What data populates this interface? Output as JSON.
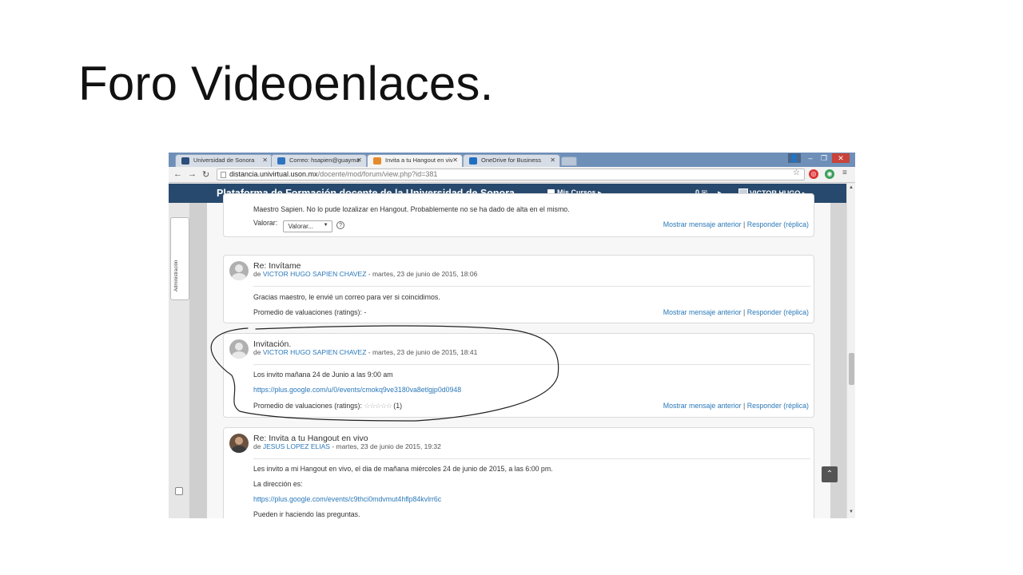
{
  "slide": {
    "title": "Foro Videoenlaces."
  },
  "browser": {
    "tabs": [
      {
        "label": "Universidad de Sonora",
        "icon": "university-favicon-icon"
      },
      {
        "label": "Correo: hsapien@guayma",
        "icon": "mail-favicon-icon"
      },
      {
        "label": "Invita a tu Hangout en viv",
        "icon": "moodle-favicon-icon"
      },
      {
        "label": "OneDrive for Business",
        "icon": "onedrive-favicon-icon"
      }
    ],
    "active_tab": 2,
    "url_host": "distancia.univirtual.uson.mx",
    "url_path": "/docente/mod/forum/view.php?id=381"
  },
  "site": {
    "title": "Plataforma de Formación docente de la Universidad de Sonora",
    "courses_label": "Mis Cursos",
    "messages_count": "0",
    "user_name": "VICTOR HUGO",
    "brand_color": "#27496d"
  },
  "sidebar": {
    "admin_label": "Administración"
  },
  "forum": {
    "action_prev": "Mostrar mensaje anterior",
    "action_reply": "Responder (réplica)",
    "partial_post": {
      "text": "Maestro Sapien. No lo pude lozalizar en Hangout. Probablemente no se ha dado de alta en el mismo.",
      "rating_label": "Valorar:",
      "rating_select": "Valorar..."
    },
    "posts": [
      {
        "subject": "Re: Invítame",
        "by": "de",
        "author": "VICTOR HUGO SAPIEN CHAVEZ",
        "date": " - martes, 23 de junio de 2015, 18:06",
        "body": [
          "Gracias maestro, le envié un correo para ver si coincidimos."
        ],
        "ratings": "Promedio de valuaciones (ratings): -"
      },
      {
        "subject": "Invitación.",
        "by": "de",
        "author": "VICTOR HUGO SAPIEN CHAVEZ",
        "date": " - martes, 23 de junio de 2015, 18:41",
        "body": [
          "Los invito mañana 24 de Junio a las 9:00 am"
        ],
        "link": "https://plus.google.com/u/0/events/cmokq9ve3180va8etlgjp0d0948",
        "ratings": "Promedio de valuaciones (ratings):",
        "stars": "☆☆☆☆☆",
        "rating_count": "(1)"
      },
      {
        "subject": "Re: Invita a tu Hangout en vivo",
        "by": "de",
        "author": "JESUS LOPEZ ELIAS",
        "date": " - martes, 23 de junio de 2015, 19:32",
        "body": [
          "Les invito a mi Hangout en vivo, el dia de mañana miércoles 24 de junio de 2015, a las 6:00 pm.",
          "La dirección es:"
        ],
        "link": "https://plus.google.com/events/c9thci0mdvmut4hflp84kvlrr6c",
        "after_link": "Pueden ir haciendo las preguntas."
      }
    ]
  }
}
